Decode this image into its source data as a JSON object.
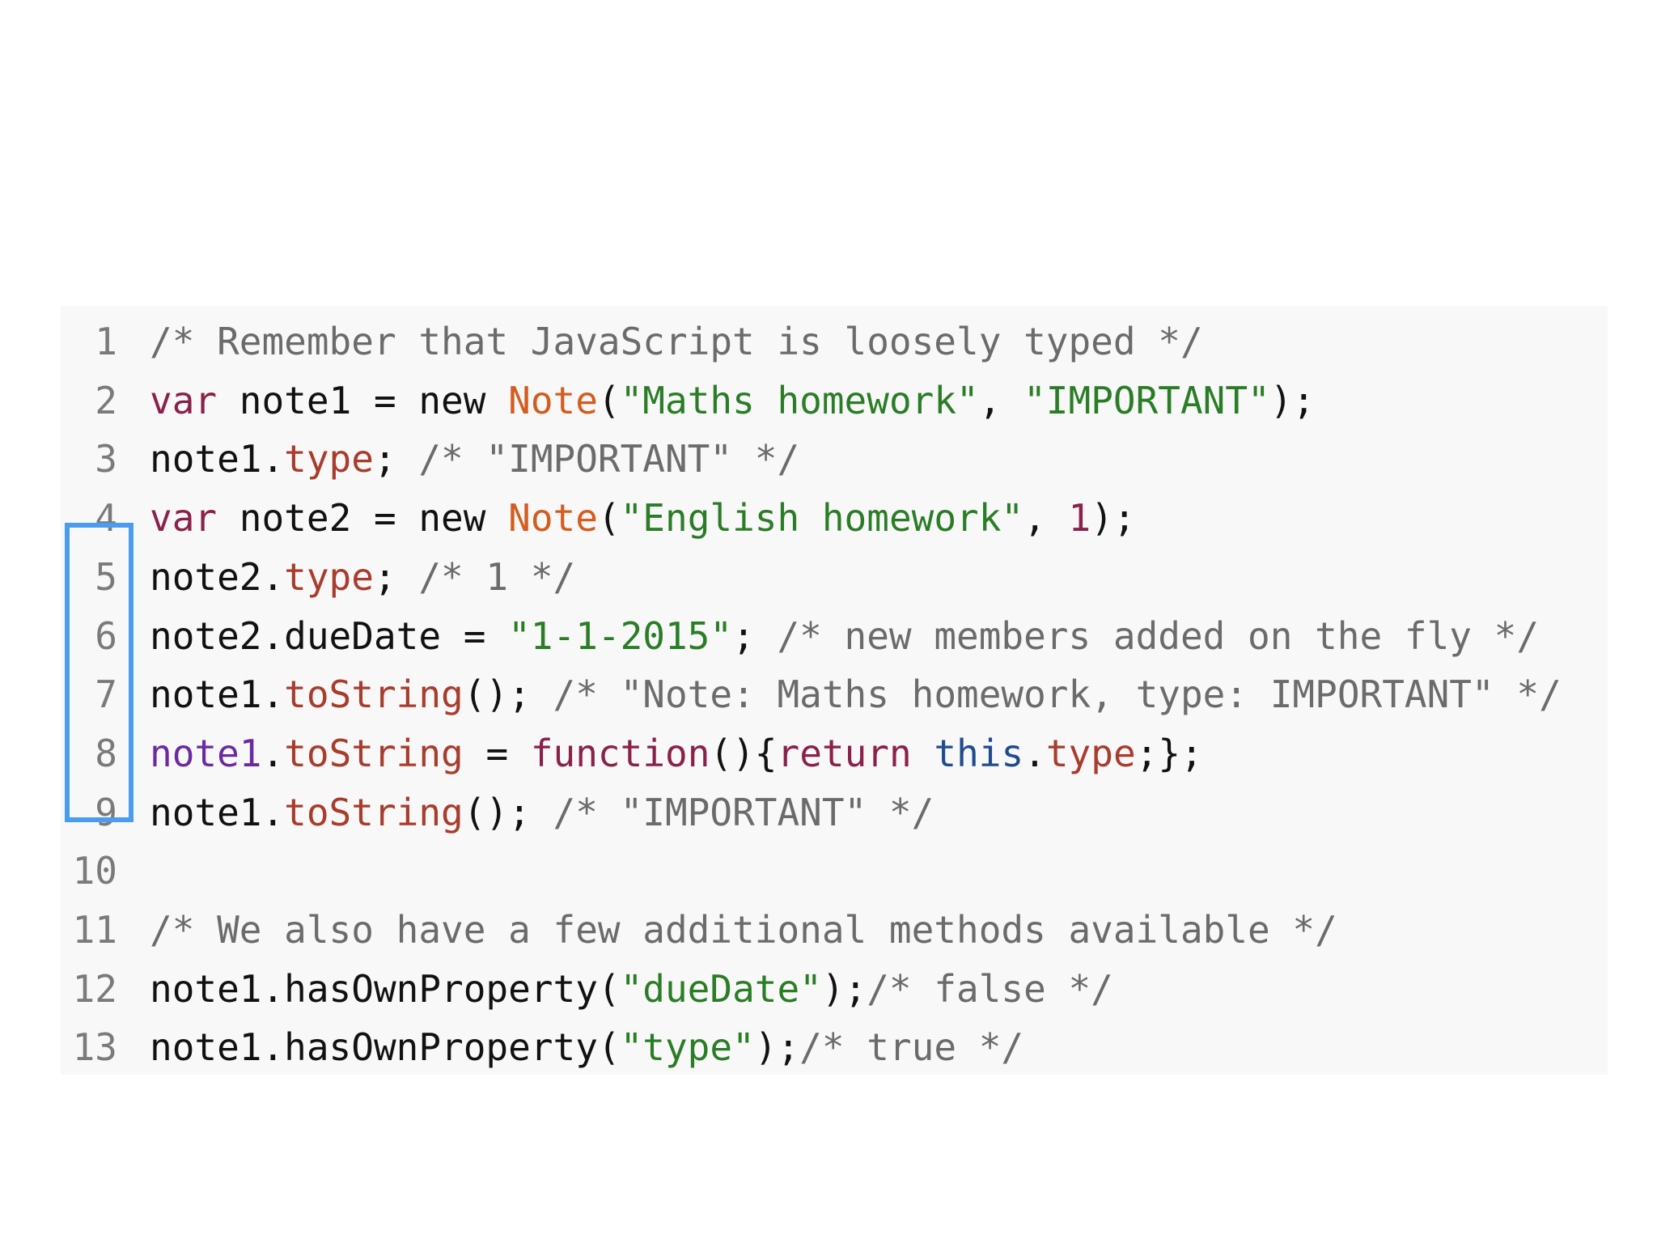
{
  "colors": {
    "panel_background": "#f8f8f8",
    "highlight_border": "#4a9cf0",
    "comment": "#6b6b6b",
    "keyword": "#8a214a",
    "string": "#2a7d26",
    "class_name": "#d35c1f",
    "property": "#a83c2d",
    "line_number": "#7a7a7a"
  },
  "highlight": {
    "from_line": 5,
    "to_line": 9
  },
  "lines": [
    {
      "number": "1",
      "tokens": [
        {
          "t": "/* Remember that JavaScript is loosely typed */",
          "c": "comment"
        }
      ]
    },
    {
      "number": "2",
      "tokens": [
        {
          "t": "var",
          "c": "keyword"
        },
        {
          "t": " note1 = new ",
          "c": "plain"
        },
        {
          "t": "Note",
          "c": "class"
        },
        {
          "t": "(",
          "c": "plain"
        },
        {
          "t": "\"Maths homework\"",
          "c": "string"
        },
        {
          "t": ", ",
          "c": "plain"
        },
        {
          "t": "\"IMPORTANT\"",
          "c": "string"
        },
        {
          "t": ");",
          "c": "plain"
        }
      ]
    },
    {
      "number": "3",
      "tokens": [
        {
          "t": "note1.",
          "c": "plain"
        },
        {
          "t": "type",
          "c": "prop"
        },
        {
          "t": "; ",
          "c": "plain"
        },
        {
          "t": "/* \"IMPORTANT\" */",
          "c": "comment"
        }
      ]
    },
    {
      "number": "4",
      "tokens": [
        {
          "t": "var",
          "c": "keyword"
        },
        {
          "t": " note2 = new ",
          "c": "plain"
        },
        {
          "t": "Note",
          "c": "class"
        },
        {
          "t": "(",
          "c": "plain"
        },
        {
          "t": "\"English homework\"",
          "c": "string"
        },
        {
          "t": ", ",
          "c": "plain"
        },
        {
          "t": "1",
          "c": "number"
        },
        {
          "t": ");",
          "c": "plain"
        }
      ]
    },
    {
      "number": "5",
      "tokens": [
        {
          "t": "note2.",
          "c": "plain"
        },
        {
          "t": "type",
          "c": "prop"
        },
        {
          "t": "; ",
          "c": "plain"
        },
        {
          "t": "/* 1 */",
          "c": "comment"
        }
      ]
    },
    {
      "number": "6",
      "tokens": [
        {
          "t": "note2.dueDate = ",
          "c": "plain"
        },
        {
          "t": "\"1-1-2015\"",
          "c": "string"
        },
        {
          "t": "; ",
          "c": "plain"
        },
        {
          "t": "/* new members added on the fly */",
          "c": "comment"
        }
      ]
    },
    {
      "number": "7",
      "tokens": [
        {
          "t": "note1.",
          "c": "plain"
        },
        {
          "t": "toString",
          "c": "prop"
        },
        {
          "t": "(); ",
          "c": "plain"
        },
        {
          "t": "/* \"Note: Maths homework, type: IMPORTANT\" */",
          "c": "comment"
        }
      ]
    },
    {
      "number": "8",
      "tokens": [
        {
          "t": "note1",
          "c": "assign"
        },
        {
          "t": ".",
          "c": "plain"
        },
        {
          "t": "toString",
          "c": "prop"
        },
        {
          "t": " = ",
          "c": "plain"
        },
        {
          "t": "function",
          "c": "func"
        },
        {
          "t": "(){",
          "c": "plain"
        },
        {
          "t": "return",
          "c": "func"
        },
        {
          "t": " ",
          "c": "plain"
        },
        {
          "t": "this",
          "c": "this"
        },
        {
          "t": ".",
          "c": "plain"
        },
        {
          "t": "type",
          "c": "prop"
        },
        {
          "t": ";};",
          "c": "plain"
        }
      ]
    },
    {
      "number": "9",
      "tokens": [
        {
          "t": "note1.",
          "c": "plain"
        },
        {
          "t": "toString",
          "c": "prop"
        },
        {
          "t": "(); ",
          "c": "plain"
        },
        {
          "t": "/* \"IMPORTANT\" */",
          "c": "comment"
        }
      ]
    },
    {
      "number": "10",
      "tokens": []
    },
    {
      "number": "11",
      "tokens": [
        {
          "t": "/* We also have a few additional methods available */",
          "c": "comment"
        }
      ]
    },
    {
      "number": "12",
      "tokens": [
        {
          "t": "note1.hasOwnProperty(",
          "c": "plain"
        },
        {
          "t": "\"dueDate\"",
          "c": "string"
        },
        {
          "t": ");",
          "c": "plain"
        },
        {
          "t": "/* false */",
          "c": "comment"
        }
      ]
    },
    {
      "number": "13",
      "tokens": [
        {
          "t": "note1.hasOwnProperty(",
          "c": "plain"
        },
        {
          "t": "\"type\"",
          "c": "string"
        },
        {
          "t": ");",
          "c": "plain"
        },
        {
          "t": "/* true */",
          "c": "comment"
        }
      ]
    }
  ]
}
